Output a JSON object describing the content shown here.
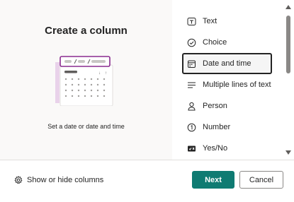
{
  "preview": {
    "title": "Create a column",
    "description": "Set a date or date and time"
  },
  "column_types": [
    {
      "label": "Text",
      "icon": "text-box-icon"
    },
    {
      "label": "Choice",
      "icon": "check-circle-icon"
    },
    {
      "label": "Date and time",
      "icon": "calendar-icon",
      "selected": true
    },
    {
      "label": "Multiple lines of text",
      "icon": "multiline-text-icon"
    },
    {
      "label": "Person",
      "icon": "person-icon"
    },
    {
      "label": "Number",
      "icon": "number-circle-icon"
    },
    {
      "label": "Yes/No",
      "icon": "toggle-icon"
    }
  ],
  "footer": {
    "show_hide_label": "Show or hide columns",
    "next_label": "Next",
    "cancel_label": "Cancel"
  },
  "colors": {
    "primary": "#0f7b72",
    "illustration_accent": "#8a2c8f",
    "illustration_shadow": "#e9d2ea"
  }
}
